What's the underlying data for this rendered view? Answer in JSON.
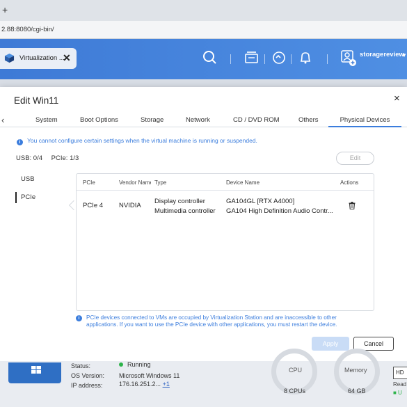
{
  "browser": {
    "new_tab": "+",
    "url": "2.88:8080/cgi-bin/"
  },
  "app_header": {
    "tab_title": "Virtualization ...",
    "tab_close": "✕",
    "username": "storagereview",
    "accent": "#3e7ad6"
  },
  "dialog": {
    "title": "Edit Win11",
    "close": "×",
    "tabs": [
      "System",
      "Boot Options",
      "Storage",
      "Network",
      "CD / DVD ROM",
      "Others",
      "Physical Devices"
    ],
    "active_tab": "Physical Devices",
    "notice": "You cannot configure certain settings when the virtual machine is running or suspended.",
    "usb_count": "USB: 0/4",
    "pcie_count": "PCIe: 1/3",
    "edit_label": "Edit",
    "side_items": [
      "USB",
      "PCIe"
    ],
    "active_side": "PCIe",
    "table": {
      "headers": [
        "PCIe",
        "Vendor Name",
        "Type",
        "Device Name",
        "Actions"
      ],
      "rows": [
        {
          "pcie": "PCIe 4",
          "vendor": "NVIDIA",
          "type1": "Display controller",
          "type2": "Multimedia controller",
          "device1": "GA104GL [RTX A4000]",
          "device2": "GA104 High Definition Audio Contr...",
          "action_icon": "trash-icon"
        }
      ]
    },
    "footer_note": "PCIe devices connected to VMs are occupied by Virtualization Station and are inaccessible to other applications. If you want to use the PCIe device with other applications, you must restart the device.",
    "apply_label": "Apply",
    "cancel_label": "Cancel"
  },
  "background": {
    "status_label": "Status:",
    "status_value": "Running",
    "os_label": "OS Version:",
    "os_value": "Microsoft Windows 11",
    "ip_label": "IP address:",
    "ip_value": "176.16.251.2...",
    "ip_more": "+1",
    "cpu_label": "CPU",
    "cpu_value": "8 CPUs",
    "memory_label": "Memory",
    "memory_value": "64 GB",
    "hd_label": "HD",
    "ready_label": "Read",
    "ready2": "■ U"
  }
}
